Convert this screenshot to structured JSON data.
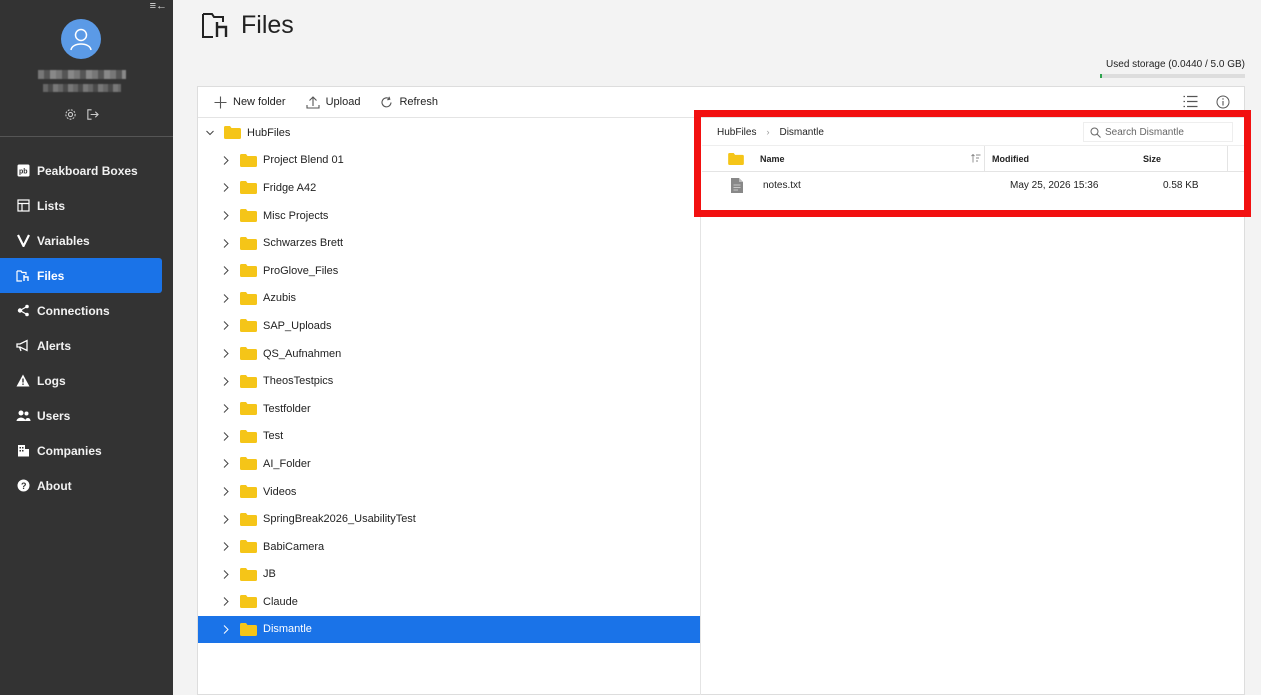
{
  "sidebar": {
    "collapse_label": "≡←",
    "nav": [
      {
        "label": "Peakboard Boxes",
        "icon": "pb-icon"
      },
      {
        "label": "Lists",
        "icon": "lists-icon"
      },
      {
        "label": "Variables",
        "icon": "variables-icon"
      },
      {
        "label": "Files",
        "icon": "files-icon",
        "active": true
      },
      {
        "label": "Connections",
        "icon": "connections-icon"
      },
      {
        "label": "Alerts",
        "icon": "megaphone-icon"
      },
      {
        "label": "Logs",
        "icon": "warning-icon"
      },
      {
        "label": "Users",
        "icon": "users-icon"
      },
      {
        "label": "Companies",
        "icon": "building-icon"
      },
      {
        "label": "About",
        "icon": "help-icon"
      }
    ]
  },
  "header": {
    "title": "Files",
    "storage_label": "Used storage (0.0440 / 5.0 GB)",
    "storage_fraction": 0.0088
  },
  "toolbar": {
    "new_folder": "New folder",
    "upload": "Upload",
    "refresh": "Refresh"
  },
  "tree": {
    "root": "HubFiles",
    "folders": [
      "Project Blend 01",
      "Fridge A42",
      "Misc Projects",
      "Schwarzes Brett",
      "ProGlove_Files",
      "Azubis",
      "SAP_Uploads",
      "QS_Aufnahmen",
      "TheosTestpics",
      "Testfolder",
      "Test",
      "AI_Folder",
      "Videos",
      "SpringBreak2026_UsabilityTest",
      "BabiCamera",
      "JB",
      "Claude",
      "Dismantle"
    ],
    "selected": "Dismantle"
  },
  "detail": {
    "breadcrumb": [
      "HubFiles",
      "Dismantle"
    ],
    "search_placeholder": "Search Dismantle",
    "columns": {
      "name": "Name",
      "modified": "Modified",
      "size": "Size"
    },
    "files": [
      {
        "name": "notes.txt",
        "modified": "May 25, 2026 15:36",
        "size": "0.58 KB"
      }
    ]
  },
  "colors": {
    "sidebar_bg": "#333333",
    "accent": "#1a73e8",
    "folder": "#f5c518",
    "highlight": "#f21010"
  }
}
